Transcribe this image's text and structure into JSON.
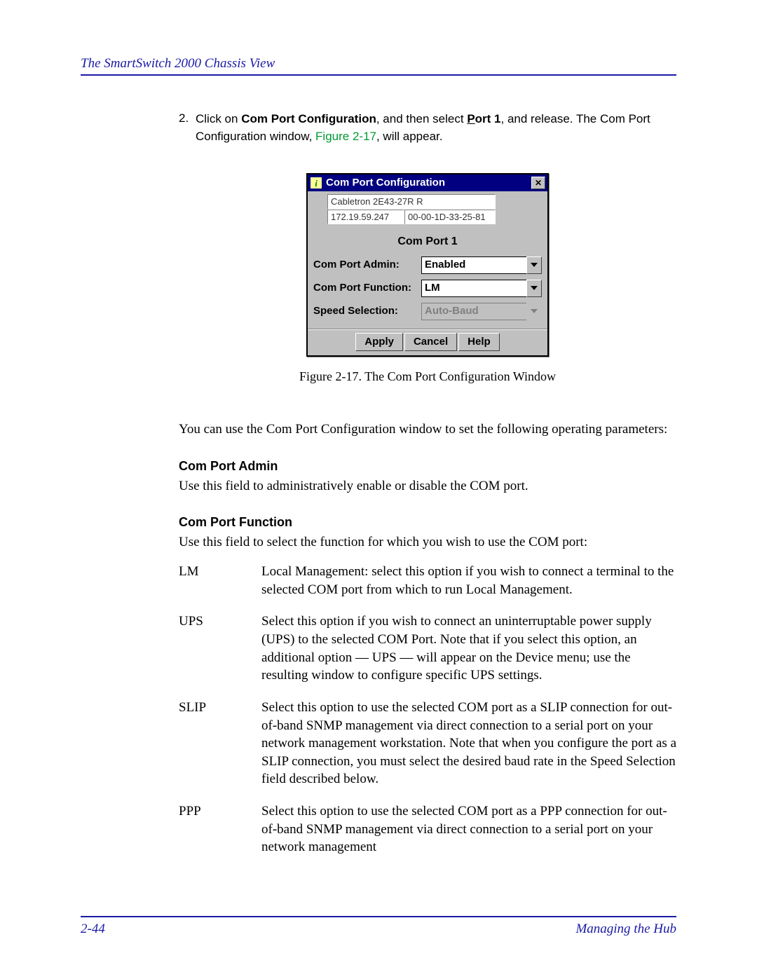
{
  "header": {
    "title": "The SmartSwitch 2000 Chassis View"
  },
  "step": {
    "num": "2.",
    "pre": "Click on ",
    "b1": "Com Port Configuration",
    "mid1": ", and then select ",
    "b2_u": "P",
    "b2_rest": "ort 1",
    "mid2": ", and release. The Com Port Configuration window, ",
    "figref": "Figure 2-17",
    "post": ", will appear."
  },
  "dialog": {
    "title": "Com Port Configuration",
    "app_icon_glyph": "i",
    "device_name": "Cabletron 2E43-27R R",
    "ip": "172.19.59.247",
    "mac": "00-00-1D-33-25-81",
    "heading": "Com Port 1",
    "rows": {
      "admin_label": "Com Port Admin:",
      "admin_value": "Enabled",
      "func_label": "Com Port Function:",
      "func_value": "LM",
      "speed_label": "Speed Selection:",
      "speed_value": "Auto-Baud"
    },
    "buttons": {
      "apply": "Apply",
      "cancel": "Cancel",
      "help": "Help"
    },
    "close_glyph": "✕"
  },
  "figcap": "Figure 2-17. The Com Port Configuration Window",
  "intro_para": "You can use the Com Port Configuration window to set the following operating parameters:",
  "admin": {
    "h": "Com Port Admin",
    "p": "Use this field to administratively enable or disable the COM port."
  },
  "func": {
    "h": "Com Port Function",
    "p": "Use this field to select the function for which you wish to use the COM port:"
  },
  "defs": [
    {
      "term": "LM",
      "desc": "Local Management: select this option if you wish to connect a terminal to the selected COM port from which to run Local Management."
    },
    {
      "term": "UPS",
      "desc": "Select this option if you wish to connect an uninterruptable power supply (UPS) to the selected COM Port. Note that if you select this option, an additional option — UPS — will appear on the Device menu; use the resulting window to configure specific UPS settings."
    },
    {
      "term": "SLIP",
      "desc": "Select this option to use the selected COM port as a SLIP connection for out-of-band SNMP management via direct connection to a serial port on your network management workstation. Note that when you configure the port as a SLIP connection, you must select the desired baud rate in the Speed Selection field described below."
    },
    {
      "term": "PPP",
      "desc": "Select this option to use the selected COM port as a PPP connection for out-of-band SNMP management via direct connection to a serial port on your network management"
    }
  ],
  "footer": {
    "left": "2-44",
    "right": "Managing the Hub"
  }
}
